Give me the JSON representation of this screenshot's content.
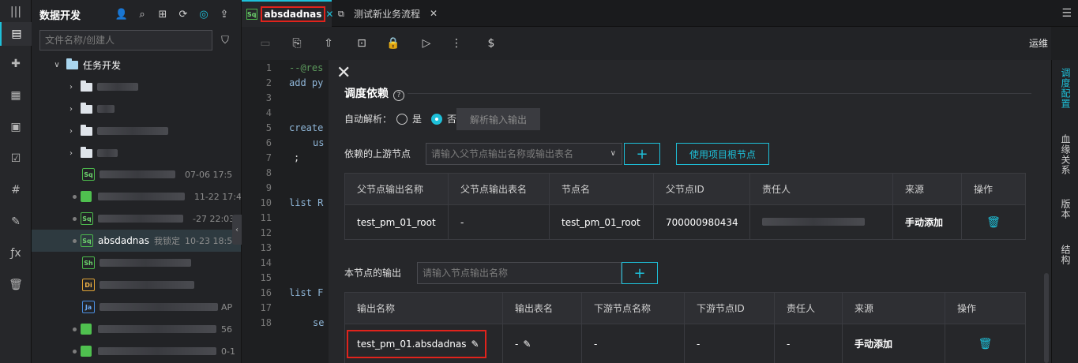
{
  "explorer": {
    "title": "数据开发",
    "search_placeholder": "文件名称/创建人",
    "root_folder": "任务开发",
    "tree": [
      {
        "kind": "folder",
        "date": ""
      },
      {
        "kind": "folder",
        "date": ""
      },
      {
        "kind": "folder",
        "date": ""
      },
      {
        "kind": "folder",
        "date": ""
      },
      {
        "kind": "sq",
        "badge": "Sq",
        "date": "07-06 17:5"
      },
      {
        "kind": "cube",
        "date": "11-22 17:4"
      },
      {
        "kind": "sq",
        "badge": "Sq",
        "date": "-27 22:03"
      },
      {
        "kind": "sq",
        "badge": "Sq",
        "name": "absdadnas",
        "lock": "我锁定",
        "date": "10-23 18:5"
      },
      {
        "kind": "sh",
        "badge": "Sh",
        "date": ""
      },
      {
        "kind": "di",
        "badge": "Di",
        "date": ""
      },
      {
        "kind": "ja",
        "badge": "Ja",
        "date": "AP"
      },
      {
        "kind": "cube",
        "date": "56"
      },
      {
        "kind": "cube",
        "date": "0-1"
      }
    ]
  },
  "tabs": [
    {
      "badge": "Sq",
      "label": "absdadnas"
    },
    {
      "label": "测试新业务流程"
    }
  ],
  "toolbar": {
    "ops_label": "运维"
  },
  "editor": {
    "lines": [
      "1",
      "2",
      "3",
      "4",
      "5",
      "6",
      "7",
      "8",
      "9",
      "10",
      "11",
      "12",
      "13",
      "14",
      "15",
      "16",
      "17",
      "18"
    ],
    "code": {
      "l1": "--@res",
      "l2": "add py",
      "l5": "create",
      "l6": "us",
      "l7": ";",
      "l10": "list R",
      "l15": "list F",
      "l18": "se"
    }
  },
  "panel": {
    "title": "调度依赖",
    "help": "?",
    "auto_parse_label": "自动解析：",
    "radio_yes": "是",
    "radio_no": "否",
    "parse_button": "解析输入输出",
    "upstream_label": "依赖的上游节点",
    "upstream_placeholder": "请输入父节点输出名称或输出表名",
    "add_symbol": "+",
    "root_button": "使用项目根节点",
    "upstream_table": {
      "headers": [
        "父节点输出名称",
        "父节点输出表名",
        "节点名",
        "父节点ID",
        "责任人",
        "来源",
        "操作"
      ],
      "rows": [
        {
          "output_name": "test_pm_01_root",
          "table": "-",
          "node": "test_pm_01_root",
          "id": "700000980434",
          "owner": "",
          "source": "手动添加"
        }
      ]
    },
    "output_label": "本节点的输出",
    "output_placeholder": "请输入节点输出名称",
    "output_table": {
      "headers": [
        "输出名称",
        "输出表名",
        "下游节点名称",
        "下游节点ID",
        "责任人",
        "来源",
        "操作"
      ],
      "rows": [
        {
          "output_name": "test_pm_01.absdadnas",
          "table": "-",
          "down_name": "-",
          "down_id": "-",
          "owner": "-",
          "source": "手动添加"
        }
      ]
    }
  },
  "right_rail": [
    "调度配置",
    "血缘关系",
    "版本",
    "结构"
  ],
  "colors": {
    "accent": "#1ec0d9",
    "highlight_box": "#e0231c"
  }
}
